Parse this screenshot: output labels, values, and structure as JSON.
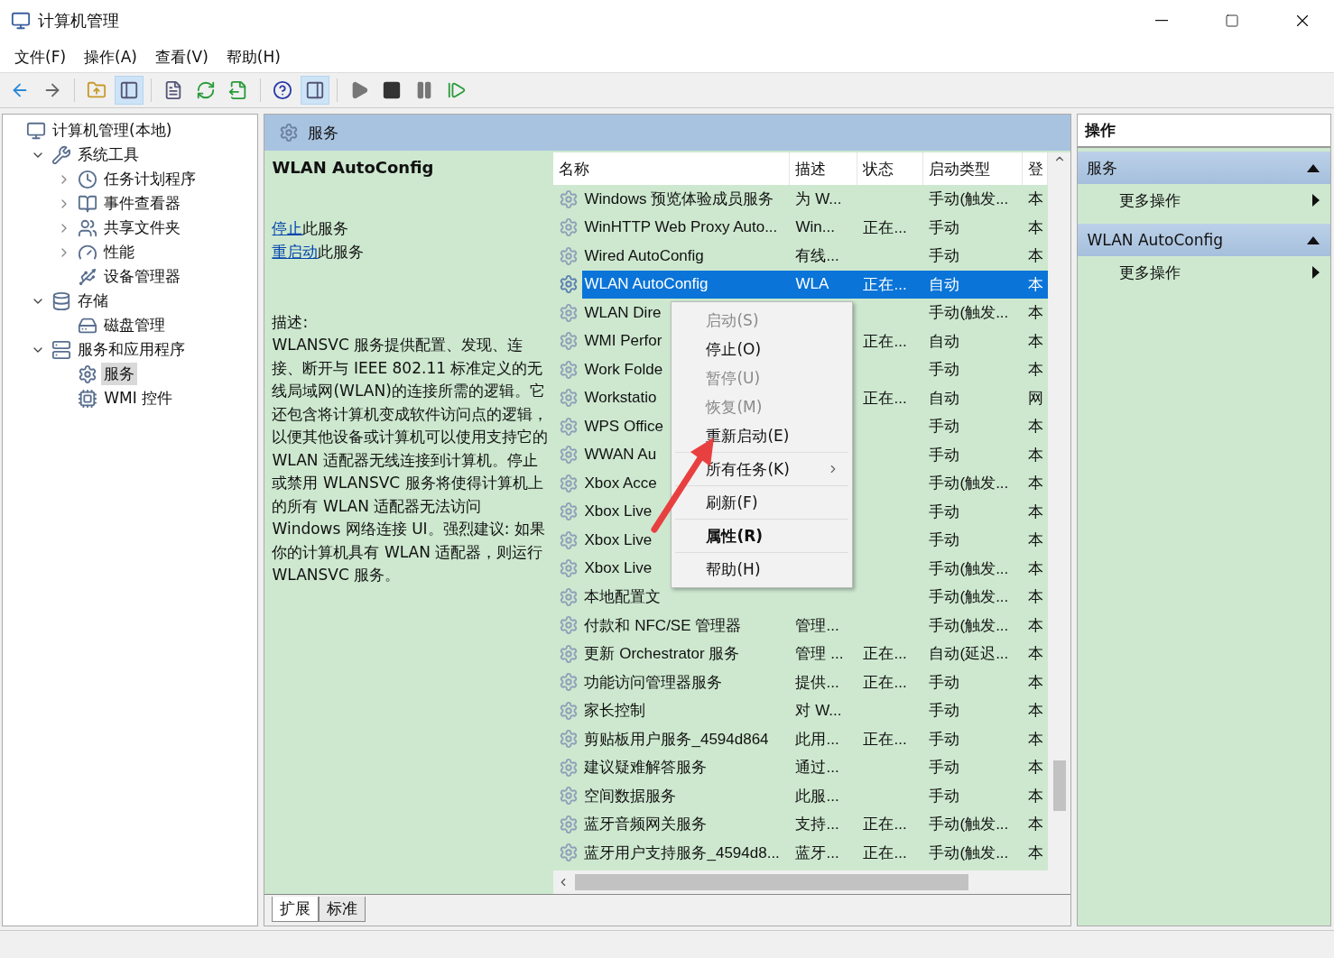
{
  "window": {
    "title": "计算机管理"
  },
  "menu_bar": [
    {
      "label": "文件(F)"
    },
    {
      "label": "操作(A)"
    },
    {
      "label": "查看(V)"
    },
    {
      "label": "帮助(H)"
    }
  ],
  "toolbar_buttons": [
    {
      "pressed": false
    },
    {
      "pressed": false
    },
    {
      "pressed": false
    },
    {
      "pressed": true
    },
    {
      "pressed": false
    },
    {
      "pressed": false
    },
    {
      "pressed": false
    },
    {
      "pressed": false
    },
    {
      "pressed": true
    },
    {
      "pressed": false
    },
    {
      "pressed": false
    },
    {
      "pressed": false
    },
    {
      "pressed": false
    }
  ],
  "tree": {
    "label": "计算机管理(本地)",
    "selected": false,
    "children": [
      {
        "label": "系统工具",
        "selected": false,
        "expanded": true,
        "children": [
          {
            "label": "任务计划程序",
            "selected": false,
            "expanded": false
          },
          {
            "label": "事件查看器",
            "selected": false,
            "expanded": false
          },
          {
            "label": "共享文件夹",
            "selected": false,
            "expanded": false
          },
          {
            "label": "性能",
            "selected": false,
            "expanded": false
          },
          {
            "label": "设备管理器",
            "selected": false
          }
        ]
      },
      {
        "label": "存储",
        "selected": false,
        "expanded": true,
        "children": [
          {
            "label": "磁盘管理",
            "selected": false
          }
        ]
      },
      {
        "label": "服务和应用程序",
        "selected": false,
        "expanded": true,
        "children": [
          {
            "label": "服务",
            "selected": true
          },
          {
            "label": "WMI 控件",
            "selected": false
          }
        ]
      }
    ]
  },
  "center": {
    "title": "服务",
    "details": {
      "title": "WLAN AutoConfig",
      "actions": [
        {
          "link": "停止",
          "text": "此服务"
        },
        {
          "link": "重启动",
          "text": "此服务"
        }
      ],
      "description_label": "描述:",
      "description": "WLANSVC 服务提供配置、发现、连接、断开与 IEEE 802.11 标准定义的无线局域网(WLAN)的连接所需的逻辑。它还包含将计算机变成软件访问点的逻辑，以便其他设备或计算机可以使用支持它的 WLAN 适配器无线连接到计算机。停止或禁用 WLANSVC 服务将使得计算机上的所有 WLAN 适配器无法访问 Windows 网络连接 UI。强烈建议: 如果你的计算机具有 WLAN 适配器，则运行 WLANSVC 服务。"
    },
    "table": {
      "columns": [
        "名称",
        "描述",
        "状态",
        "启动类型",
        "登"
      ],
      "rows": [
        {
          "cells": [
            "Windows 预览体验成员服务",
            "为 W...",
            "",
            "手动(触发...",
            "本"
          ],
          "selected": false
        },
        {
          "cells": [
            "WinHTTP Web Proxy Auto...",
            "Win...",
            "正在...",
            "手动",
            "本"
          ],
          "selected": false
        },
        {
          "cells": [
            "Wired AutoConfig",
            "有线...",
            "",
            "手动",
            "本"
          ],
          "selected": false
        },
        {
          "cells": [
            "WLAN AutoConfig",
            "WLA",
            "正在...",
            "自动",
            "本"
          ],
          "selected": true
        },
        {
          "cells": [
            "WLAN Dire",
            "",
            "",
            "手动(触发...",
            "本"
          ],
          "selected": false
        },
        {
          "cells": [
            "WMI Perfor",
            "",
            "正在...",
            "自动",
            "本"
          ],
          "selected": false
        },
        {
          "cells": [
            "Work Folde",
            "",
            "",
            "手动",
            "本"
          ],
          "selected": false
        },
        {
          "cells": [
            "Workstatio",
            "",
            "正在...",
            "自动",
            "网"
          ],
          "selected": false
        },
        {
          "cells": [
            "WPS Office",
            "",
            "",
            "手动",
            "本"
          ],
          "selected": false
        },
        {
          "cells": [
            "WWAN Au",
            "",
            "",
            "手动",
            "本"
          ],
          "selected": false
        },
        {
          "cells": [
            "Xbox Acce",
            "",
            "",
            "手动(触发...",
            "本"
          ],
          "selected": false
        },
        {
          "cells": [
            "Xbox Live",
            "",
            "",
            "手动",
            "本"
          ],
          "selected": false
        },
        {
          "cells": [
            "Xbox Live",
            "",
            "",
            "手动",
            "本"
          ],
          "selected": false
        },
        {
          "cells": [
            "Xbox Live",
            "",
            "",
            "手动(触发...",
            "本"
          ],
          "selected": false
        },
        {
          "cells": [
            "本地配置文",
            "",
            "",
            "手动(触发...",
            "本"
          ],
          "selected": false
        },
        {
          "cells": [
            "付款和 NFC/SE 管理器",
            "管理...",
            "",
            "手动(触发...",
            "本"
          ],
          "selected": false
        },
        {
          "cells": [
            "更新 Orchestrator 服务",
            "管理 ...",
            "正在...",
            "自动(延迟...",
            "本"
          ],
          "selected": false
        },
        {
          "cells": [
            "功能访问管理器服务",
            "提供...",
            "正在...",
            "手动",
            "本"
          ],
          "selected": false
        },
        {
          "cells": [
            "家长控制",
            "对 W...",
            "",
            "手动",
            "本"
          ],
          "selected": false
        },
        {
          "cells": [
            "剪贴板用户服务_4594d864",
            "此用...",
            "正在...",
            "手动",
            "本"
          ],
          "selected": false
        },
        {
          "cells": [
            "建议疑难解答服务",
            "通过...",
            "",
            "手动",
            "本"
          ],
          "selected": false
        },
        {
          "cells": [
            "空间数据服务",
            "此服...",
            "",
            "手动",
            "本"
          ],
          "selected": false
        },
        {
          "cells": [
            "蓝牙音频网关服务",
            "支持...",
            "正在...",
            "手动(触发...",
            "本"
          ],
          "selected": false
        },
        {
          "cells": [
            "蓝牙用户支持服务_4594d8...",
            "蓝牙...",
            "正在...",
            "手动(触发...",
            "本"
          ],
          "selected": false
        }
      ]
    },
    "bottom_tabs": [
      {
        "label": "扩展",
        "selected": true
      },
      {
        "label": "标准",
        "selected": false
      }
    ]
  },
  "context_menu": {
    "groups": [
      [
        {
          "label": "启动(S)",
          "disabled": true
        },
        {
          "label": "停止(O)",
          "disabled": false
        },
        {
          "label": "暂停(U)",
          "disabled": true
        },
        {
          "label": "恢复(M)",
          "disabled": true
        },
        {
          "label": "重新启动(E)",
          "disabled": false
        }
      ],
      [
        {
          "label": "所有任务(K)",
          "disabled": false,
          "submenu": true
        }
      ],
      [
        {
          "label": "刷新(F)",
          "disabled": false
        }
      ],
      [
        {
          "label": "属性(R)",
          "disabled": false,
          "default": true
        }
      ],
      [
        {
          "label": "帮助(H)",
          "disabled": false
        }
      ]
    ]
  },
  "actions_pane": {
    "title": "操作",
    "sections": [
      {
        "title": "服务",
        "expanded": true,
        "items": [
          {
            "label": "更多操作",
            "submenu": true
          }
        ]
      },
      {
        "title": "WLAN AutoConfig",
        "expanded": true,
        "items": [
          {
            "label": "更多操作",
            "submenu": true
          }
        ]
      }
    ]
  }
}
